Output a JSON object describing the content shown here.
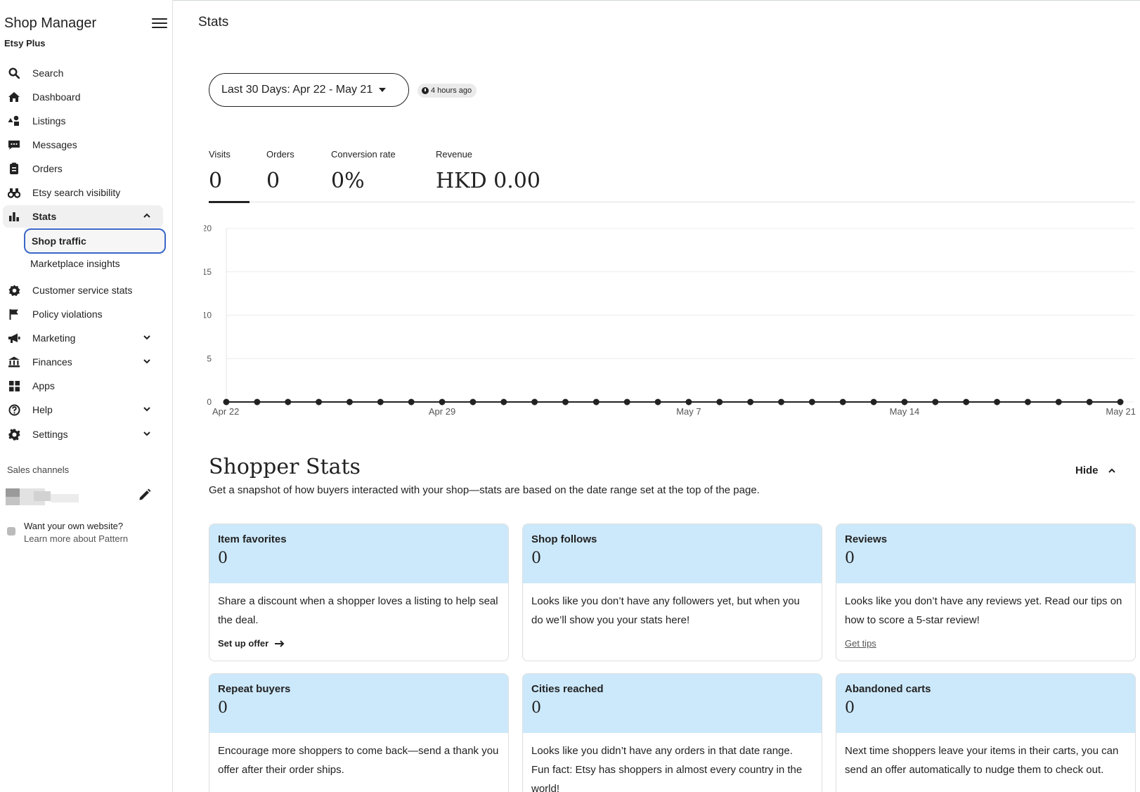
{
  "sidebar": {
    "title": "Shop Manager",
    "subtitle": "Etsy Plus",
    "items": [
      {
        "label": "Search",
        "icon": "search-icon"
      },
      {
        "label": "Dashboard",
        "icon": "home-icon"
      },
      {
        "label": "Listings",
        "icon": "shapes-icon"
      },
      {
        "label": "Messages",
        "icon": "chat-icon"
      },
      {
        "label": "Orders",
        "icon": "clipboard-icon"
      },
      {
        "label": "Etsy search visibility",
        "icon": "binoculars-icon"
      },
      {
        "label": "Stats",
        "icon": "bar-chart-icon",
        "expanded": true
      },
      {
        "label": "Customer service stats",
        "icon": "gear-badge-icon"
      },
      {
        "label": "Policy violations",
        "icon": "flag-icon"
      },
      {
        "label": "Marketing",
        "icon": "megaphone-icon"
      },
      {
        "label": "Finances",
        "icon": "bank-icon"
      },
      {
        "label": "Apps",
        "icon": "grid-icon"
      },
      {
        "label": "Help",
        "icon": "question-icon"
      },
      {
        "label": "Settings",
        "icon": "gear-icon"
      }
    ],
    "stats_sub": [
      {
        "label": "Shop traffic",
        "selected": true
      },
      {
        "label": "Marketplace insights"
      }
    ],
    "sales_channels_label": "Sales channels",
    "pattern_title": "Want your own website?",
    "pattern_link": "Learn more about Pattern"
  },
  "page": {
    "title": "Stats",
    "date_range": "Last 30 Days: Apr 22 - May 21",
    "updated": "4 hours ago"
  },
  "metrics": [
    {
      "label": "Visits",
      "value": "0"
    },
    {
      "label": "Orders",
      "value": "0"
    },
    {
      "label": "Conversion rate",
      "value": "0%"
    },
    {
      "label": "Revenue",
      "value": "HKD 0.00"
    }
  ],
  "chart_data": {
    "type": "line",
    "title": "",
    "xlabel": "",
    "ylabel": "",
    "ylim": [
      0,
      20
    ],
    "yticks": [
      0,
      5,
      10,
      15,
      20
    ],
    "x_start": "Apr 22",
    "x_end": "May 21",
    "xtick_labels": [
      "Apr 22",
      "Apr 29",
      "May 7",
      "May 14",
      "May 21"
    ],
    "xtick_indices": [
      0,
      7,
      15,
      22,
      29
    ],
    "grid": true,
    "series": [
      {
        "values": [
          0,
          0,
          0,
          0,
          0,
          0,
          0,
          0,
          0,
          0,
          0,
          0,
          0,
          0,
          0,
          0,
          0,
          0,
          0,
          0,
          0,
          0,
          0,
          0,
          0,
          0,
          0,
          0,
          0,
          0
        ]
      }
    ]
  },
  "shopper": {
    "title": "Shopper Stats",
    "subtitle": "Get a snapshot of how buyers interacted with your shop—stats are based on the date range set at the top of the page.",
    "hide_label": "Hide",
    "cards": [
      {
        "title": "Item favorites",
        "value": "0",
        "body": "Share a discount when a shopper loves a listing to help seal the deal.",
        "link": "Set up offer"
      },
      {
        "title": "Shop follows",
        "value": "0",
        "body": "Looks like you don’t have any followers yet, but when you do we’ll show you your stats here!"
      },
      {
        "title": "Reviews",
        "value": "0",
        "body": "Looks like you don’t have any reviews yet. Read our tips on how to score a 5-star review!",
        "link": "Get tips"
      },
      {
        "title": "Repeat buyers",
        "value": "0",
        "body": "Encourage more shoppers to come back—send a thank you offer after their order ships."
      },
      {
        "title": "Cities reached",
        "value": "0",
        "body": "Looks like you didn’t have any orders in that date range. Fun fact: Etsy has shoppers in almost every country in the world!"
      },
      {
        "title": "Abandoned carts",
        "value": "0",
        "body": "Next time shoppers leave your items in their carts, you can send an offer automatically to nudge them to check out."
      }
    ]
  }
}
